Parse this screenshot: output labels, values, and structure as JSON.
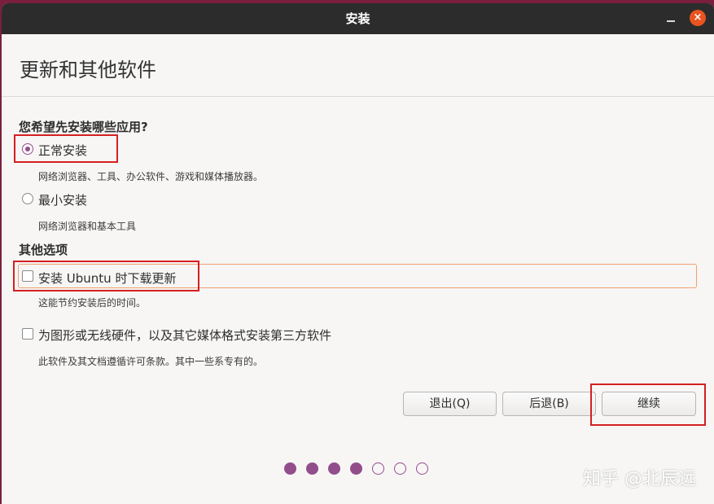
{
  "window": {
    "title": "安装",
    "close_glyph": "×"
  },
  "page": {
    "title": "更新和其他软件"
  },
  "install_type": {
    "question": "您希望先安装哪些应用?",
    "options": [
      {
        "label": "正常安装",
        "description": "网络浏览器、工具、办公软件、游戏和媒体播放器。",
        "selected": true
      },
      {
        "label": "最小安装",
        "description": "网络浏览器和基本工具",
        "selected": false
      }
    ]
  },
  "other_options": {
    "heading": "其他选项",
    "items": [
      {
        "label": "安装 Ubuntu 时下载更新",
        "description": "这能节约安装后的时间。",
        "checked": false
      },
      {
        "label": "为图形或无线硬件，以及其它媒体格式安装第三方软件",
        "description": "此软件及其文档遵循许可条款。其中一些系专有的。",
        "checked": false
      }
    ]
  },
  "buttons": {
    "quit": "退出(Q)",
    "back": "后退(B)",
    "continue": "继续"
  },
  "progress": {
    "total_steps": 7,
    "completed_steps": 4
  },
  "watermark": "知乎 @北辰远",
  "colors": {
    "accent": "#924d8b",
    "titlebar": "#2c2c2c",
    "close_button": "#e95420",
    "highlight_box": "#d32020"
  }
}
